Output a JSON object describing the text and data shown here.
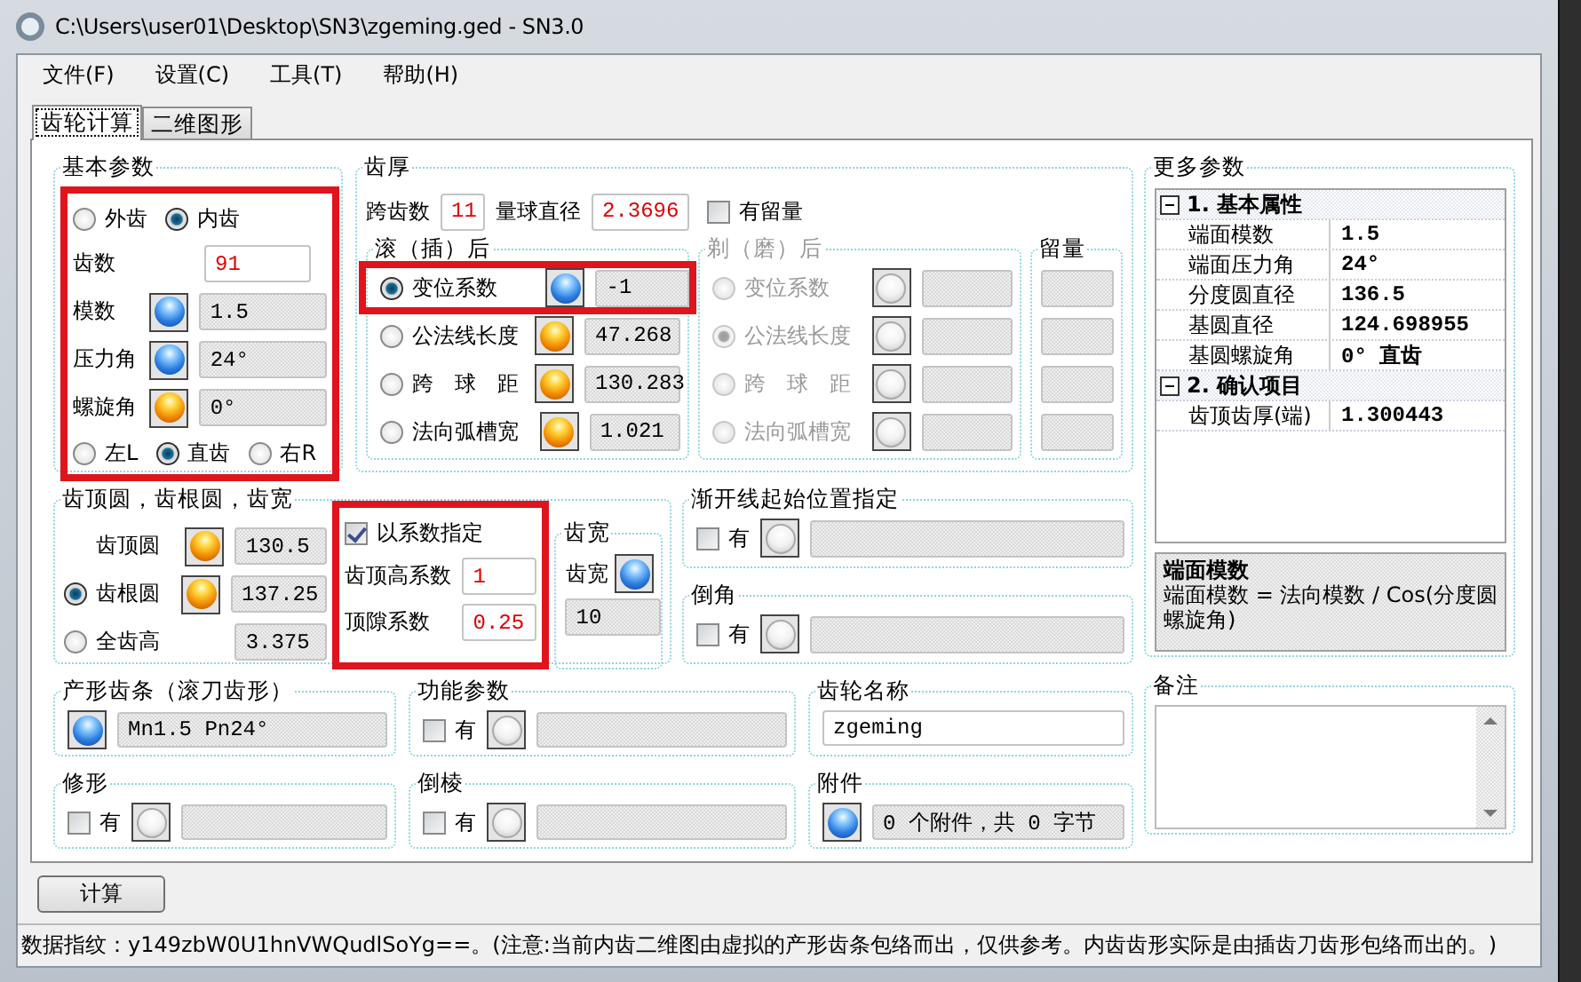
{
  "window": {
    "title": "C:\\Users\\user01\\Desktop\\SN3\\zgeming.ged - SN3.0"
  },
  "menu": [
    "文件(F)",
    "设置(C)",
    "工具(T)",
    "帮助(H)"
  ],
  "tabs": [
    {
      "label": "齿轮计算",
      "selected": true
    },
    {
      "label": "二维图形",
      "selected": false
    }
  ],
  "basic": {
    "title": "基本参数",
    "highlighted": true,
    "gear_type": [
      {
        "label": "外齿",
        "selected": false
      },
      {
        "label": "内齿",
        "selected": true
      }
    ],
    "fields": [
      {
        "label": "齿数",
        "value": "91",
        "kind": "input"
      },
      {
        "label": "模数",
        "button": {
          "kind": "blue"
        },
        "value": "1.5",
        "kind": "readonly"
      },
      {
        "label": "压力角",
        "button": {
          "kind": "blue"
        },
        "value": "24°",
        "kind": "readonly"
      },
      {
        "label": "螺旋角",
        "button": {
          "kind": "orange"
        },
        "value": "0°",
        "kind": "readonly"
      }
    ],
    "hand": [
      {
        "label": "左L",
        "selected": false
      },
      {
        "label": "直齿",
        "selected": true
      },
      {
        "label": "右R",
        "selected": false
      }
    ]
  },
  "thickness": {
    "title": "齿厚",
    "span_label": "跨齿数",
    "span_value": "11",
    "ball_label": "量球直径",
    "ball_value": "2.3696",
    "allowance": {
      "label": "有留量",
      "checked": false
    },
    "after_hobbing": {
      "title": "滚（插）后",
      "disabled": false,
      "rows": [
        {
          "label": "变位系数",
          "selected": true,
          "button": {
            "kind": "blue"
          },
          "value": "-1",
          "highlighted": true
        },
        {
          "label": "公法线长度",
          "selected": false,
          "button": {
            "kind": "orange"
          },
          "value": "47.268",
          "highlighted": false
        },
        {
          "label": "跨　球　距",
          "selected": false,
          "button": {
            "kind": "orange"
          },
          "value": "130.283",
          "highlighted": false
        },
        {
          "label": "法向弧槽宽",
          "selected": false,
          "button": {
            "kind": "orange"
          },
          "value": "1.021",
          "highlighted": false
        }
      ]
    },
    "after_shaving": {
      "title": "剃（磨）后",
      "disabled": true,
      "rows": [
        {
          "label": "变位系数",
          "selected": false,
          "button": {
            "kind": "gray"
          },
          "highlighted": false
        },
        {
          "label": "公法线长度",
          "selected": true,
          "button": {
            "kind": "gray"
          },
          "highlighted": false
        },
        {
          "label": "跨　球　距",
          "selected": false,
          "button": {
            "kind": "gray"
          },
          "highlighted": false
        },
        {
          "label": "法向弧槽宽",
          "selected": false,
          "button": {
            "kind": "gray"
          },
          "highlighted": false
        }
      ]
    },
    "allowance_column": {
      "title": "留量"
    }
  },
  "more": {
    "title": "更多参数",
    "sections": [
      {
        "title": "1. 基本属性",
        "expanded": true,
        "items": [
          {
            "name": "端面模数",
            "value": "1.5"
          },
          {
            "name": "端面压力角",
            "value": "24°"
          },
          {
            "name": "分度圆直径",
            "value": "136.5"
          },
          {
            "name": "基圆直径",
            "value": "124.698955"
          },
          {
            "name": "基圆螺旋角",
            "value": "0° 直齿"
          }
        ]
      },
      {
        "title": "2. 确认项目",
        "expanded": true,
        "items": [
          {
            "name": "齿顶齿厚(端)",
            "value": "1.300443"
          }
        ]
      }
    ],
    "description": {
      "title": "端面模数",
      "text": "端面模数 = 法向模数 / Cos(分度圆螺旋角)"
    }
  },
  "circles": {
    "title": "齿顶圆，齿根圆，齿宽",
    "rows": [
      {
        "label": "齿顶圆",
        "kind": "plain",
        "button": {
          "kind": "orange"
        },
        "value": "130.5"
      },
      {
        "label": "齿根圆",
        "kind": "radio",
        "selected": true,
        "button": {
          "kind": "orange"
        },
        "value": "137.25"
      },
      {
        "label": "全齿高",
        "kind": "radio",
        "selected": false,
        "value": "3.375"
      }
    ],
    "coefficients": {
      "highlighted": true,
      "check": {
        "label": "以系数指定",
        "checked": true
      },
      "fields": [
        {
          "label": "齿顶高系数",
          "value": "1"
        },
        {
          "label": "顶隙系数",
          "value": "0.25"
        }
      ]
    },
    "width": {
      "title": "齿宽",
      "label": "齿宽",
      "button": {
        "kind": "blue"
      },
      "value": "10"
    }
  },
  "involute_start": {
    "title": "渐开线起始位置指定",
    "check": {
      "label": "有",
      "checked": false
    }
  },
  "chamfer": {
    "title": "倒角",
    "check": {
      "label": "有",
      "checked": false
    }
  },
  "rack": {
    "title": "产形齿条（滚刀齿形）",
    "button": {
      "kind": "blue"
    },
    "value": "Mn1.5 Pn24°"
  },
  "function_params": {
    "title": "功能参数",
    "check": {
      "label": "有",
      "checked": false
    }
  },
  "gear_name": {
    "title": "齿轮名称",
    "value": "zgeming"
  },
  "notes": {
    "title": "备注"
  },
  "modification": {
    "title": "修形",
    "check": {
      "label": "有",
      "checked": false
    }
  },
  "edge_chamfer": {
    "title": "倒棱",
    "check": {
      "label": "有",
      "checked": false
    }
  },
  "attachments": {
    "title": "附件",
    "button": {
      "kind": "blue"
    },
    "value": "0 个附件，共 0 字节"
  },
  "calculate_button": "计算",
  "status_bar": "数据指纹：y149zbW0U1hnVWQudlSoYg==。(注意:当前内齿二维图由虚拟的产形齿条包络而出，仅供参考。内齿齿形实际是由插齿刀齿形包络而出的。)"
}
